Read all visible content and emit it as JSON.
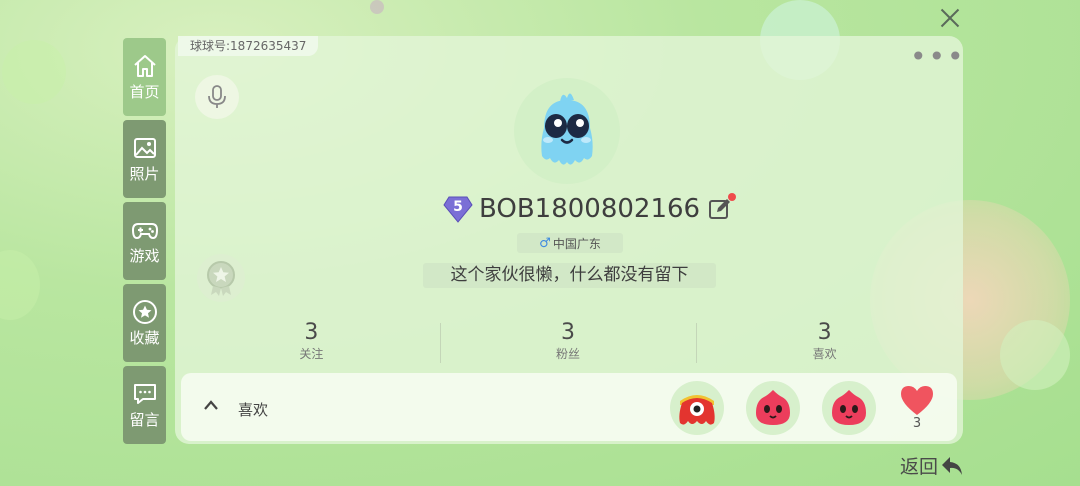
{
  "profile": {
    "id_label": "球球号:1872635437",
    "level": "5",
    "username": "BOB1800802166",
    "gender_symbol": "♂",
    "location": "中国广东",
    "bio": "这个家伙很懒，什么都没有留下"
  },
  "sidebar": {
    "items": [
      {
        "label": "首页",
        "icon": "home-icon",
        "active": true
      },
      {
        "label": "照片",
        "icon": "image-icon"
      },
      {
        "label": "游戏",
        "icon": "gamepad-icon"
      },
      {
        "label": "收藏",
        "icon": "star-icon"
      },
      {
        "label": "留言",
        "icon": "message-icon"
      }
    ]
  },
  "stats": [
    {
      "value": "3",
      "label": "关注"
    },
    {
      "value": "3",
      "label": "粉丝"
    },
    {
      "value": "3",
      "label": "喜欢"
    }
  ],
  "likes": {
    "label": "喜欢",
    "heart_count": "3"
  },
  "footer": {
    "back_label": "返回"
  },
  "colors": {
    "accent_green": "#9dc98a",
    "sidebar_inactive": "#7e9a72",
    "level_badge": "#7b6fd6",
    "heart": "#f0545f",
    "notify_dot": "#ef4b4b"
  }
}
